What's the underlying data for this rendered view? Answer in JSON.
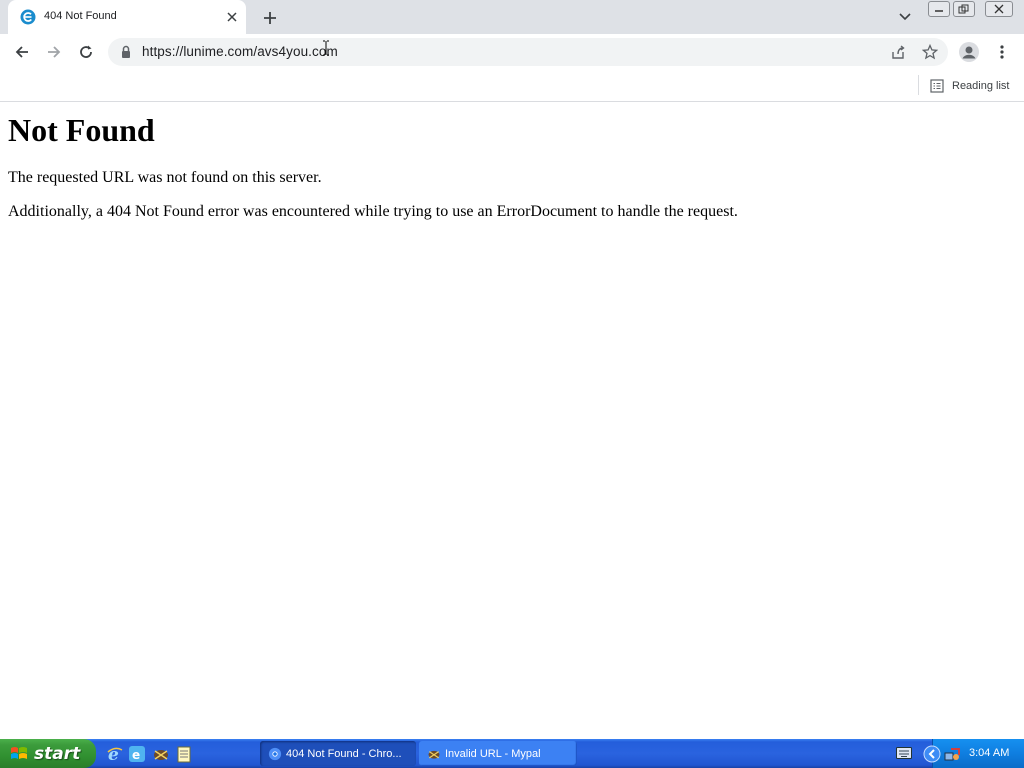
{
  "browser": {
    "tab": {
      "title": "404 Not Found",
      "favicon": "chrome-tab-favicon"
    },
    "new_tab": "plus-icon",
    "url": "https://lunime.com/avs4you.com",
    "reading_list_label": "Reading list",
    "icons": [
      "back-arrow-icon",
      "forward-arrow-icon",
      "reload-icon",
      "lock-icon",
      "share-icon",
      "star-icon",
      "profile-icon",
      "kebab-menu-icon",
      "reading-list-icon",
      "chevron-down-icon"
    ]
  },
  "page": {
    "heading": "Not Found",
    "line1": "The requested URL was not found on this server.",
    "line2": "Additionally, a 404 Not Found error was encountered while trying to use an ErrorDocument to handle the request."
  },
  "taskbar": {
    "start_label": "start",
    "buttons": [
      {
        "label": "404 Not Found - Chro...",
        "active": true
      },
      {
        "label": "Invalid URL - Mypal",
        "active": false
      }
    ],
    "clock": "3:04 AM"
  },
  "colors": {
    "tabstrip": "#dee1e6",
    "omnibox": "#f1f3f4",
    "taskbar_blue": "#245edb",
    "start_green": "#309030"
  }
}
